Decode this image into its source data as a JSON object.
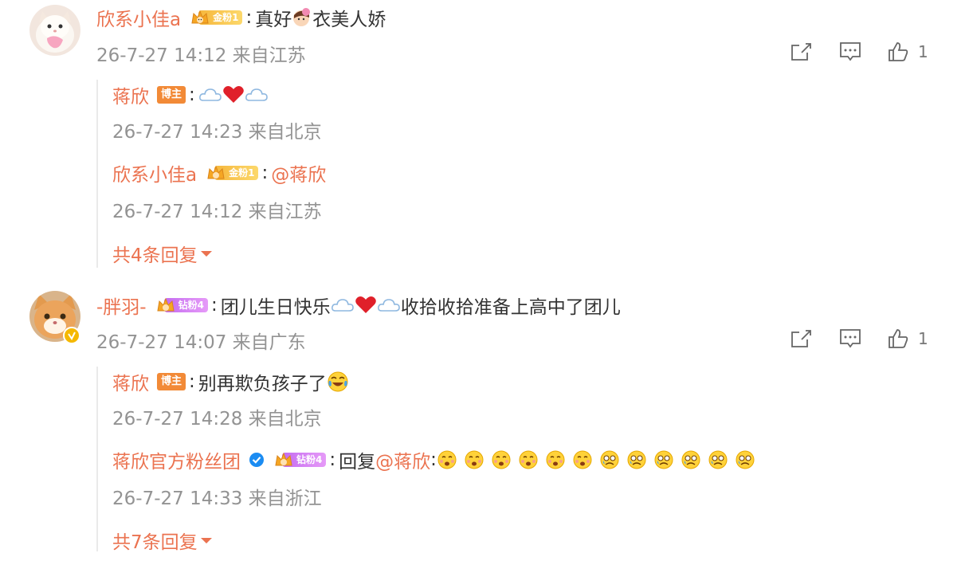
{
  "comments": [
    {
      "user": "欣系小佳a",
      "fan_badge": "金粉1",
      "text_before": "真好",
      "text_after": "衣美人娇",
      "time": "26-7-27 14:12 来自江苏",
      "likes": "1",
      "replies": [
        {
          "user": "蒋欣",
          "role": "博主",
          "time": "26-7-27 14:23 来自北京"
        },
        {
          "user": "欣系小佳a",
          "fan_badge": "金粉1",
          "mention": "@蒋欣",
          "time": "26-7-27 14:12 来自江苏"
        }
      ],
      "more_replies": "共4条回复"
    },
    {
      "user": "-胖羽-",
      "fan_badge": "钻粉4",
      "text_before": "团儿生日快乐",
      "text_after": "收拾收拾准备上高中了团儿",
      "time": "26-7-27 14:07 来自广东",
      "likes": "1",
      "replies": [
        {
          "user": "蒋欣",
          "role": "博主",
          "text": "别再欺负孩子了",
          "time": "26-7-27 14:28 来自北京"
        },
        {
          "user": "蒋欣官方粉丝团",
          "fan_badge": "钻粉4",
          "text": "回复",
          "mention": "@蒋欣",
          "time": "26-7-27 14:33 来自浙江"
        }
      ],
      "more_replies": "共7条回复"
    }
  ],
  "colors": {
    "name": "#eb7350",
    "meta": "#939393",
    "text": "#333333",
    "gold": "#f6b73c",
    "diamond": "#c46cf0",
    "blogger": "#f28a37"
  },
  "icons": [
    "share-icon",
    "comment-icon",
    "like-icon",
    "cloud-emoji",
    "heart-emoji",
    "laugh-cry-emoji",
    "pout-emoji",
    "teary-emoji",
    "verified-icon",
    "crown-icon",
    "caret-down-icon"
  ]
}
